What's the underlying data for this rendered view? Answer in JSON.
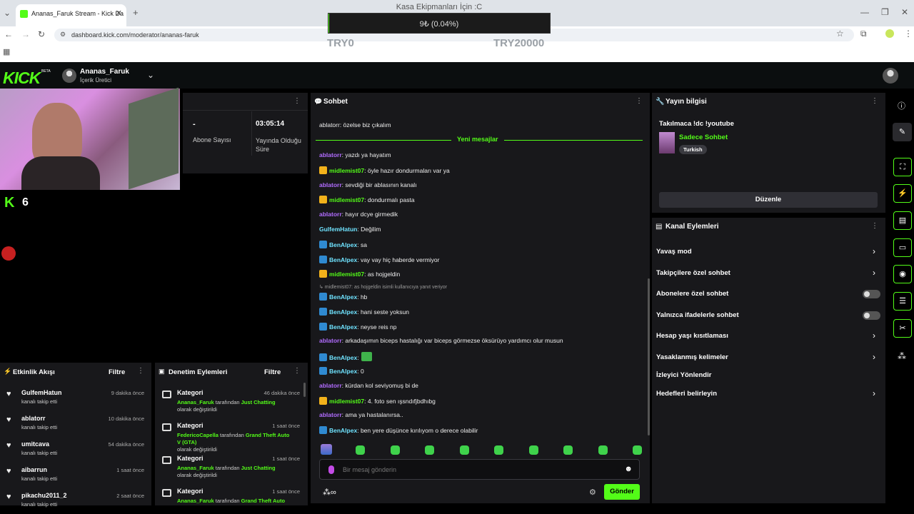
{
  "browser": {
    "tab_title": "Ananas_Faruk Stream - Kick Da",
    "url": "dashboard.kick.com/moderator/ananas-faruk"
  },
  "overlay": {
    "title": "Kasa Ekipmanları İçin :C",
    "progress_text": "9₺ (0.04%)",
    "progress_fraction": 0.0004,
    "min_label": "TRY0",
    "max_label": "TRY20000",
    "accent": "#53fc18"
  },
  "header": {
    "logo": "KICK",
    "beta": "BETA",
    "username": "Ananas_Faruk",
    "role": "İçerik Üretici"
  },
  "stats": {
    "subs_value": "-",
    "subs_label": "Abone Sayısı",
    "time_value": "03:05:14",
    "time_label": "Yayında Olduğu Süre",
    "viewers": "6"
  },
  "chat": {
    "title": "Sohbet",
    "new_messages": "Yeni mesajlar",
    "top_partial": "ablatorr: özelse biz çıkalım",
    "messages": [
      {
        "user": "ablatorr",
        "text": ": yazdı ya hayatım",
        "color": "purple",
        "badge": ""
      },
      {
        "user": "midlemist07",
        "text": ": öyle hazır dondurmaları var ya",
        "color": "green",
        "badge": "crown"
      },
      {
        "user": "ablatorr",
        "text": ": sevdiği bir ablasının kanalı",
        "color": "purple",
        "badge": ""
      },
      {
        "user": "midlemist07",
        "text": ": dondurmalı pasta",
        "color": "green",
        "badge": "crown"
      },
      {
        "user": "ablatorr",
        "text": ": hayır dcye girmedik",
        "color": "purple",
        "badge": ""
      },
      {
        "user": "GulfemHatun",
        "text": ": Değilim",
        "color": "cyan",
        "badge": ""
      },
      {
        "user": "BenAlpex",
        "text": ": sa",
        "color": "cyan",
        "badge": "blue"
      },
      {
        "user": "BenAlpex",
        "text": ": vay vay hiç haberde vermiyor",
        "color": "cyan",
        "badge": "blue"
      },
      {
        "user": "midlemist07",
        "text": ": as hojgeldin",
        "color": "green",
        "badge": "crown"
      }
    ],
    "reply_note": "↳ midlemist07: as hojgeldin isimli kullanıcıya yanıt veriyor",
    "messages2": [
      {
        "user": "BenAlpex",
        "text": ": hb",
        "color": "cyan",
        "badge": "blue"
      },
      {
        "user": "BenAlpex",
        "text": ": hani seste yoksun",
        "color": "cyan",
        "badge": "blue"
      },
      {
        "user": "BenAlpex",
        "text": ": neyse reis np",
        "color": "cyan",
        "badge": "blue"
      },
      {
        "user": "ablatorr",
        "text": ": arkadaşımın biceps hastalığı var biceps görmezse öksürüyo yardımcı olur musun",
        "color": "purple",
        "badge": ""
      },
      {
        "user": "BenAlpex",
        "text": ":",
        "color": "cyan",
        "badge": "blue"
      },
      {
        "user": "BenAlpex",
        "text": ": 0",
        "color": "cyan",
        "badge": "blue"
      },
      {
        "user": "ablatorr",
        "text": ": kürdan kol seviyomuş bi de",
        "color": "purple",
        "badge": ""
      },
      {
        "user": "midlemist07",
        "text": ": 4. foto sen ışsndıfjbdhıbg",
        "color": "green",
        "badge": "crown"
      },
      {
        "user": "ablatorr",
        "text": ": ama ya hastalanırsa..",
        "color": "purple",
        "badge": ""
      },
      {
        "user": "BenAlpex",
        "text": ": ben yere düşünce kırılıyom o derece olabilir",
        "color": "cyan",
        "badge": "blue"
      }
    ],
    "input_placeholder": "Bir mesaj gönderin",
    "send_label": "Gönder"
  },
  "stream_info": {
    "title": "Yayın bilgisi",
    "stream_title": "Takılmaca !dc !youtube",
    "category": "Sadece Sohbet",
    "language": "Turkish",
    "edit_label": "Düzenle"
  },
  "channel_actions": {
    "title": "Kanal Eylemleri",
    "items": [
      "Yavaş mod",
      "Takipçilere özel sohbet",
      "Abonelere özel sohbet",
      "Yalnızca ifadelerle sohbet",
      "Hesap yaşı kısıtlaması",
      "Yasaklanmış kelimeler",
      "İzleyici Yönlendir",
      "Hedefleri belirleyin"
    ]
  },
  "activity": {
    "title": "Etkinlik Akışı",
    "filter": "Filtre",
    "items": [
      {
        "name": "GulfemHatun",
        "sub": "kanalı takip etti",
        "time": "9 dakika önce"
      },
      {
        "name": "ablatorr",
        "sub": "kanalı takip etti",
        "time": "10 dakika önce"
      },
      {
        "name": "umitcava",
        "sub": "kanalı takip etti",
        "time": "54 dakika önce"
      },
      {
        "name": "aibarrun",
        "sub": "kanalı takip etti",
        "time": "1 saat önce"
      },
      {
        "name": "pikachu2011_2",
        "sub": "kanalı takip etti",
        "time": "2 saat önce"
      }
    ]
  },
  "moderation": {
    "title": "Denetim Eylemleri",
    "filter": "Filtre",
    "items": [
      {
        "title": "Kategori",
        "who": "Ananas_Faruk",
        "mid": " tarafından ",
        "what": "Just Chatting",
        "end": "olarak değiştirildi",
        "time": "46 dakika önce"
      },
      {
        "title": "Kategori",
        "who": "FedericoCapella",
        "mid": " tarafından ",
        "what": "Grand Theft Auto V (GTA)",
        "end": "olarak değiştirildi",
        "time": "1 saat önce"
      },
      {
        "title": "Kategori",
        "who": "Ananas_Faruk",
        "mid": " tarafından ",
        "what": "Just Chatting",
        "end": "olarak değiştirildi",
        "time": "1 saat önce"
      },
      {
        "title": "Kategori",
        "who": "Ananas_Faruk",
        "mid": " tarafından ",
        "what": "Grand Theft Auto",
        "end": "",
        "time": "1 saat önce"
      }
    ]
  }
}
